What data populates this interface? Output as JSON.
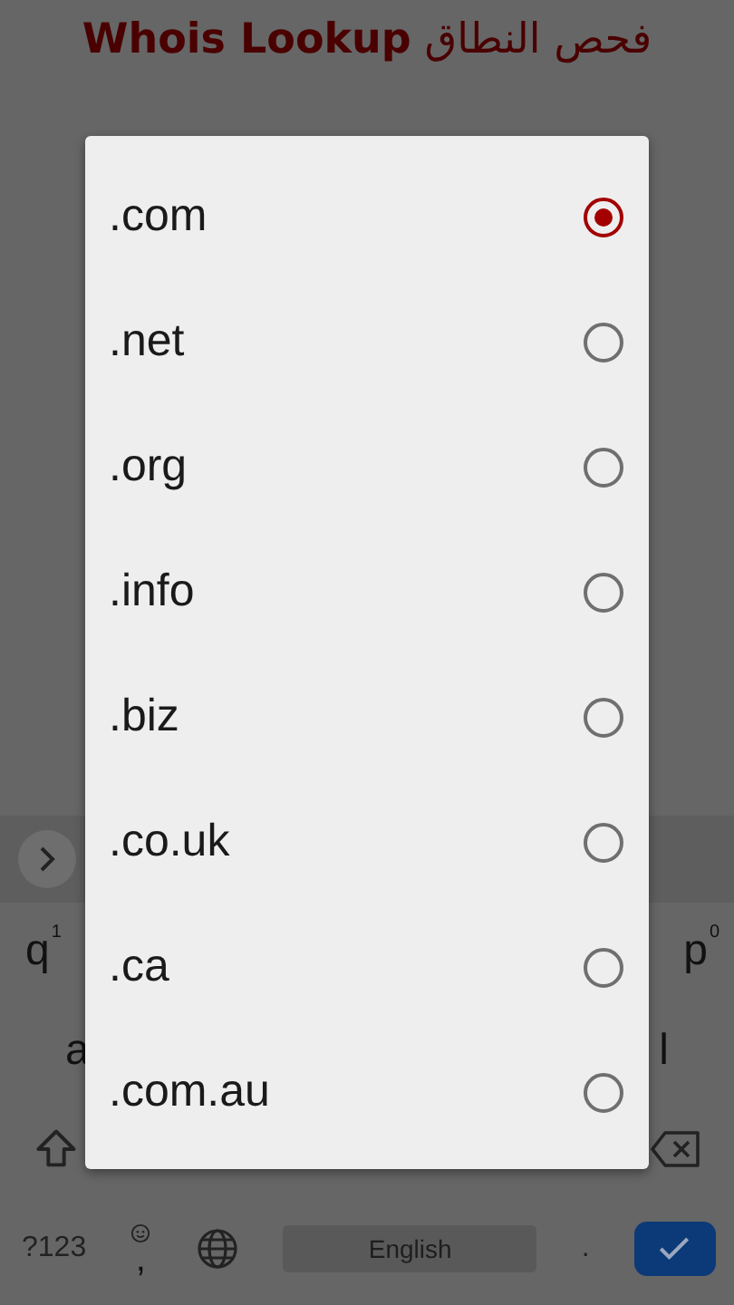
{
  "header": {
    "title": "**Whois Lookup** فحص النطاق"
  },
  "dialog": {
    "options": [
      {
        "label": ".com",
        "selected": true
      },
      {
        "label": ".net",
        "selected": false
      },
      {
        "label": ".org",
        "selected": false
      },
      {
        "label": ".info",
        "selected": false
      },
      {
        "label": ".biz",
        "selected": false
      },
      {
        "label": ".co.uk",
        "selected": false
      },
      {
        "label": ".ca",
        "selected": false
      },
      {
        "label": ".com.au",
        "selected": false
      }
    ]
  },
  "keyboard": {
    "rows": [
      [
        {
          "kind": "letter",
          "label": "q",
          "hint": "1"
        },
        {
          "kind": "letter",
          "label": "p",
          "hint": "0"
        }
      ],
      [
        {
          "kind": "letter",
          "label": "a"
        },
        {
          "kind": "letter",
          "label": "l"
        }
      ],
      [
        {
          "kind": "shift"
        },
        {
          "kind": "backspace"
        }
      ],
      [
        {
          "kind": "text",
          "label": "?123"
        },
        {
          "kind": "emoji",
          "label": ","
        },
        {
          "kind": "globe"
        },
        {
          "kind": "space",
          "label": "English"
        },
        {
          "kind": "text",
          "label": "."
        },
        {
          "kind": "enter"
        }
      ]
    ]
  }
}
